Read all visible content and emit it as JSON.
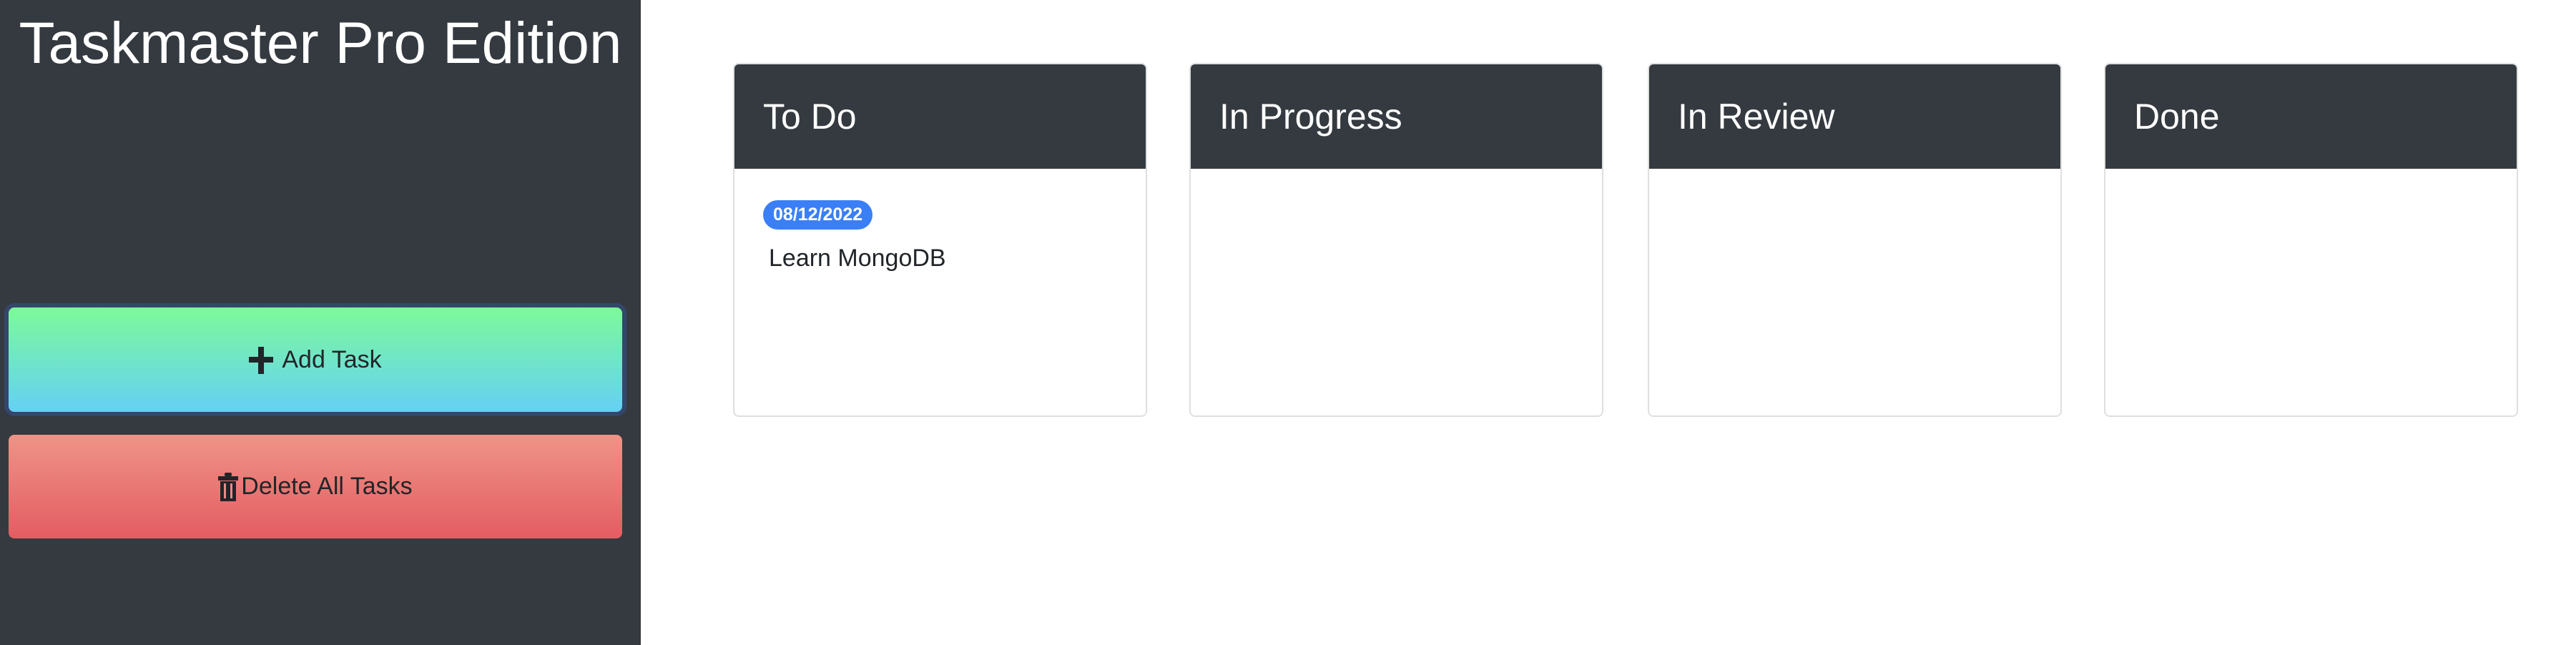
{
  "sidebar": {
    "title": "Taskmaster Pro Edition",
    "add_task_label": "Add Task",
    "delete_all_label": "Delete All Tasks",
    "add_icon": "plus-icon",
    "delete_icon": "trash-icon"
  },
  "board": {
    "columns": [
      {
        "title": "To Do",
        "tasks": [
          {
            "date": "08/12/2022",
            "text": "Learn MongoDB"
          }
        ]
      },
      {
        "title": "In Progress",
        "tasks": []
      },
      {
        "title": "In Review",
        "tasks": []
      },
      {
        "title": "Done",
        "tasks": []
      }
    ]
  },
  "colors": {
    "sidebar": "#343a40",
    "badge": "#3a7ff6"
  }
}
